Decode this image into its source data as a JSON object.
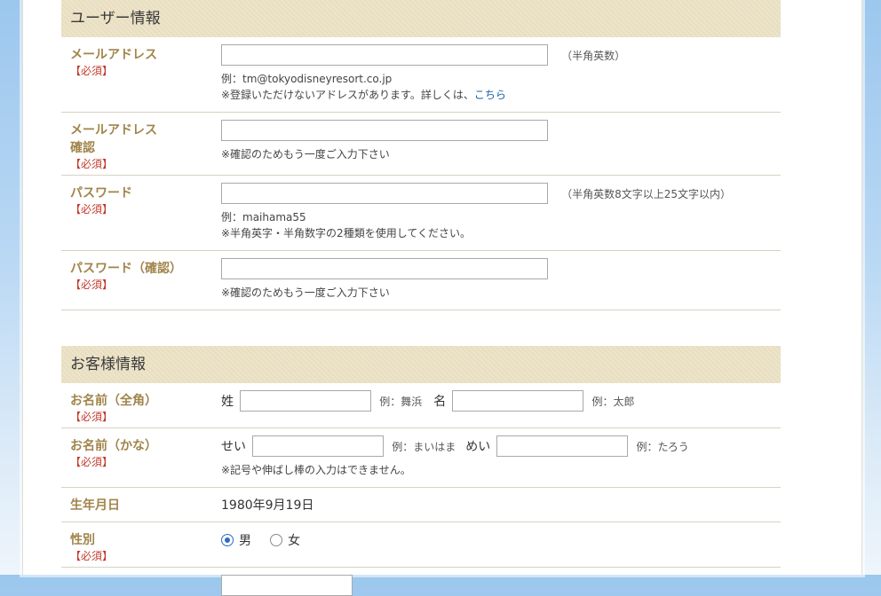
{
  "user_info": {
    "heading": "ユーザー情報",
    "email": {
      "label": "メールアドレス",
      "required": "【必須】",
      "value": "",
      "hint": "（半角英数）",
      "example": "例：tm@tokyodisneyresort.co.jp",
      "note": "※登録いただけないアドレスがあります。詳しくは、",
      "link": "こちら"
    },
    "email_confirm": {
      "label_line1": "メールアドレス",
      "label_line2": "確認",
      "required": "【必須】",
      "value": "",
      "note": "※確認のためもう一度ご入力下さい"
    },
    "password": {
      "label": "パスワード",
      "required": "【必須】",
      "value": "",
      "hint": "（半角英数8文字以上25文字以内）",
      "example": "例：maihama55",
      "note": "※半角英字・半角数字の2種類を使用してください。"
    },
    "password_confirm": {
      "label": "パスワード（確認）",
      "required": "【必須】",
      "value": "",
      "note": "※確認のためもう一度ご入力下さい"
    }
  },
  "customer_info": {
    "heading": "お客様情報",
    "name_kanji": {
      "label": "お名前（全角）",
      "required": "【必須】",
      "last_label": "姓",
      "last_value": "",
      "last_example": "例：舞浜",
      "first_label": "名",
      "first_value": "",
      "first_example": "例：太郎"
    },
    "name_kana": {
      "label": "お名前（かな）",
      "required": "【必須】",
      "last_label": "せい",
      "last_value": "",
      "last_example": "例：まいはま",
      "first_label": "めい",
      "first_value": "",
      "first_example": "例：たろう",
      "note": "※記号や伸ばし棒の入力はできません。"
    },
    "birthdate": {
      "label": "生年月日",
      "value": "1980年9月19日"
    },
    "gender": {
      "label": "性別",
      "required": "【必須】",
      "options": [
        "男",
        "女"
      ],
      "selected": "男"
    }
  },
  "colors": {
    "label": "#a0844a",
    "required": "#c0392b",
    "section_header": "#ece2c6",
    "link": "#1a5fa0",
    "radio_selected": "#2b6cc4"
  }
}
